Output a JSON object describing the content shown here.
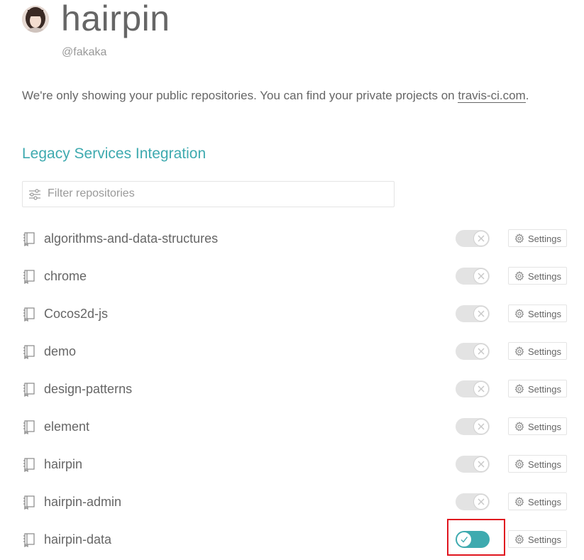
{
  "profile": {
    "name": "hairpin",
    "handle": "@fakaka"
  },
  "notice": {
    "text": "We're only showing your public repositories. You can find your private projects on ",
    "link_label": "travis-ci.com",
    "suffix": "."
  },
  "section": {
    "title": "Legacy Services Integration"
  },
  "filter": {
    "placeholder": "Filter repositories",
    "value": ""
  },
  "settings_label": "Settings",
  "repositories": [
    {
      "name": "algorithms-and-data-structures",
      "active": false
    },
    {
      "name": "chrome",
      "active": false
    },
    {
      "name": "Cocos2d-js",
      "active": false
    },
    {
      "name": "demo",
      "active": false
    },
    {
      "name": "design-patterns",
      "active": false
    },
    {
      "name": "element",
      "active": false
    },
    {
      "name": "hairpin",
      "active": false
    },
    {
      "name": "hairpin-admin",
      "active": false
    },
    {
      "name": "hairpin-data",
      "active": true
    }
  ],
  "colors": {
    "accent": "#3eaaaf",
    "highlight": "#e0151f",
    "toggle_off": "#e3e3e3"
  }
}
